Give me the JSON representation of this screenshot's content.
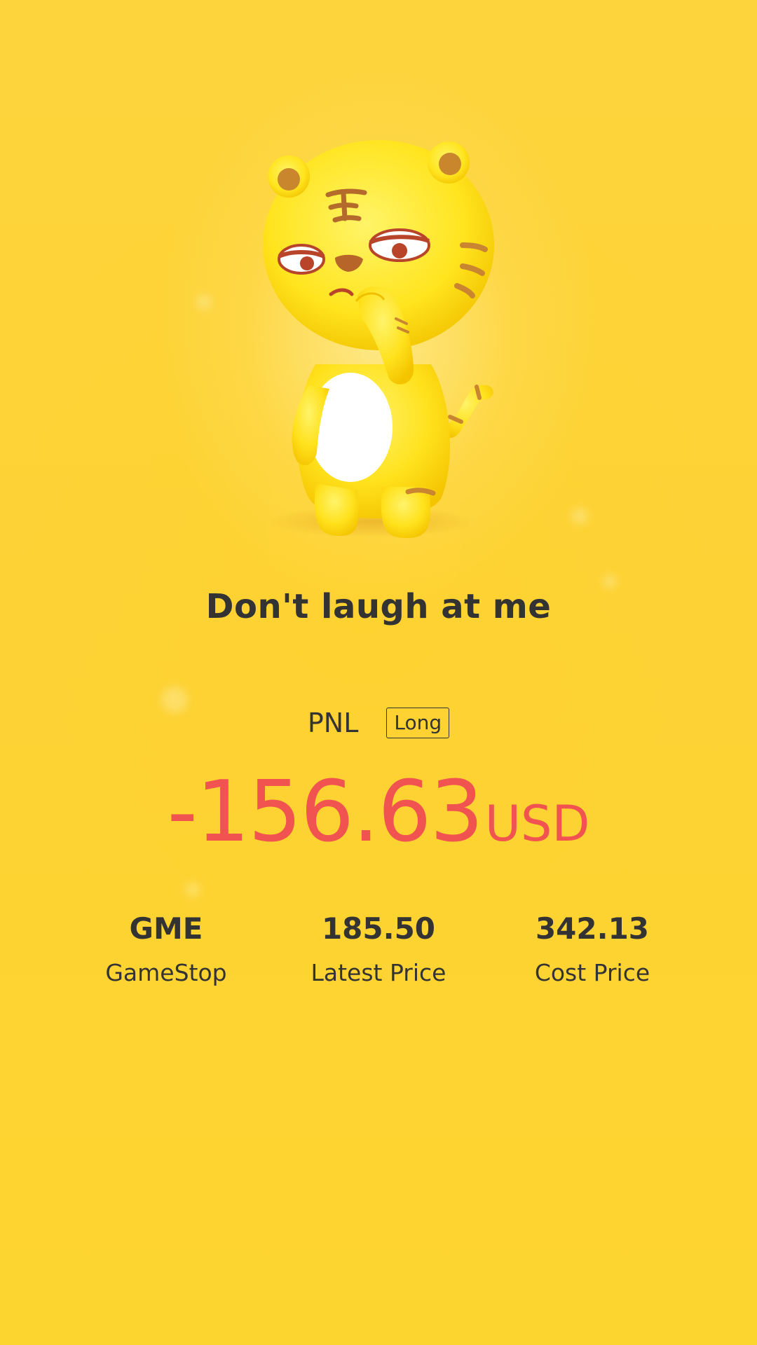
{
  "message": "Don't laugh at me",
  "pnl": {
    "label": "PNL",
    "direction": "Long",
    "value": "-156.63",
    "currency": "USD",
    "value_color": "#f05350"
  },
  "stats": [
    {
      "value": "GME",
      "label": "GameStop"
    },
    {
      "value": "185.50",
      "label": "Latest Price"
    },
    {
      "value": "342.13",
      "label": "Cost Price"
    }
  ],
  "mascot": {
    "icon": "sad-tiger-mascot-icon"
  },
  "colors": {
    "background": "#fdd433",
    "text": "#333333",
    "loss": "#f05350"
  }
}
